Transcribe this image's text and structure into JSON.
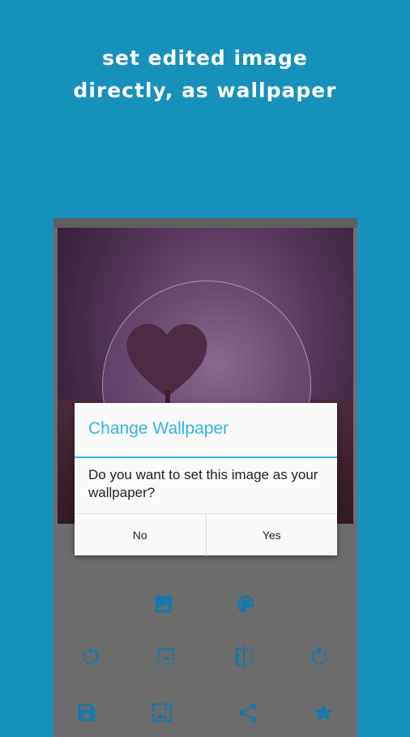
{
  "headline": {
    "line1": "set edited image",
    "line2": "directly, as wallpaper"
  },
  "dialog": {
    "title": "Change Wallpaper",
    "message": "Do you want to set this image as your wallpaper?",
    "no_label": "No",
    "yes_label": "Yes"
  },
  "toolbar": {
    "row1": [
      "image-icon",
      "palette-icon"
    ],
    "row2": [
      "rotate-left-icon",
      "flip-vertical-icon",
      "flip-horizontal-icon",
      "rotate-right-icon"
    ],
    "row3": [
      "save-icon",
      "wallpaper-icon",
      "share-icon",
      "star-icon"
    ]
  },
  "colors": {
    "background": "#1591bb",
    "accent": "#33b5e5",
    "icon": "#1a78a8"
  }
}
